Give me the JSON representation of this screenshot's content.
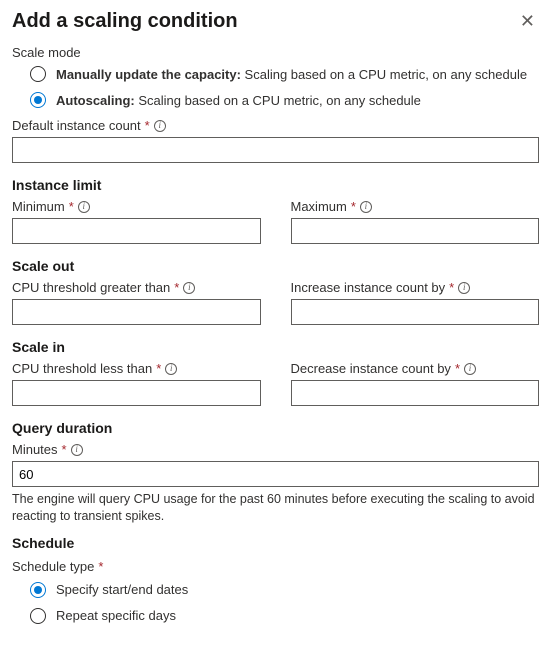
{
  "header": {
    "title": "Add a scaling condition"
  },
  "scaleMode": {
    "label": "Scale mode",
    "manual": {
      "bold": "Manually update the capacity:",
      "rest": " Scaling based on a CPU metric, on any schedule"
    },
    "auto": {
      "bold": "Autoscaling:",
      "rest": " Scaling based on a CPU metric, on any schedule"
    }
  },
  "defaultInstance": {
    "label": "Default instance count",
    "value": ""
  },
  "instanceLimit": {
    "title": "Instance limit",
    "min": {
      "label": "Minimum",
      "value": ""
    },
    "max": {
      "label": "Maximum",
      "value": ""
    }
  },
  "scaleOut": {
    "title": "Scale out",
    "threshold": {
      "label": "CPU threshold greater than",
      "value": ""
    },
    "increase": {
      "label": "Increase instance count by",
      "value": ""
    }
  },
  "scaleIn": {
    "title": "Scale in",
    "threshold": {
      "label": "CPU threshold less than",
      "value": ""
    },
    "decrease": {
      "label": "Decrease instance count by",
      "value": ""
    }
  },
  "queryDuration": {
    "title": "Query duration",
    "minutes": {
      "label": "Minutes",
      "value": "60"
    },
    "helper": "The engine will query CPU usage for the past 60 minutes before executing the scaling to avoid reacting to transient spikes."
  },
  "schedule": {
    "title": "Schedule",
    "typeLabel": "Schedule type",
    "specify": "Specify start/end dates",
    "repeat": "Repeat specific days"
  }
}
